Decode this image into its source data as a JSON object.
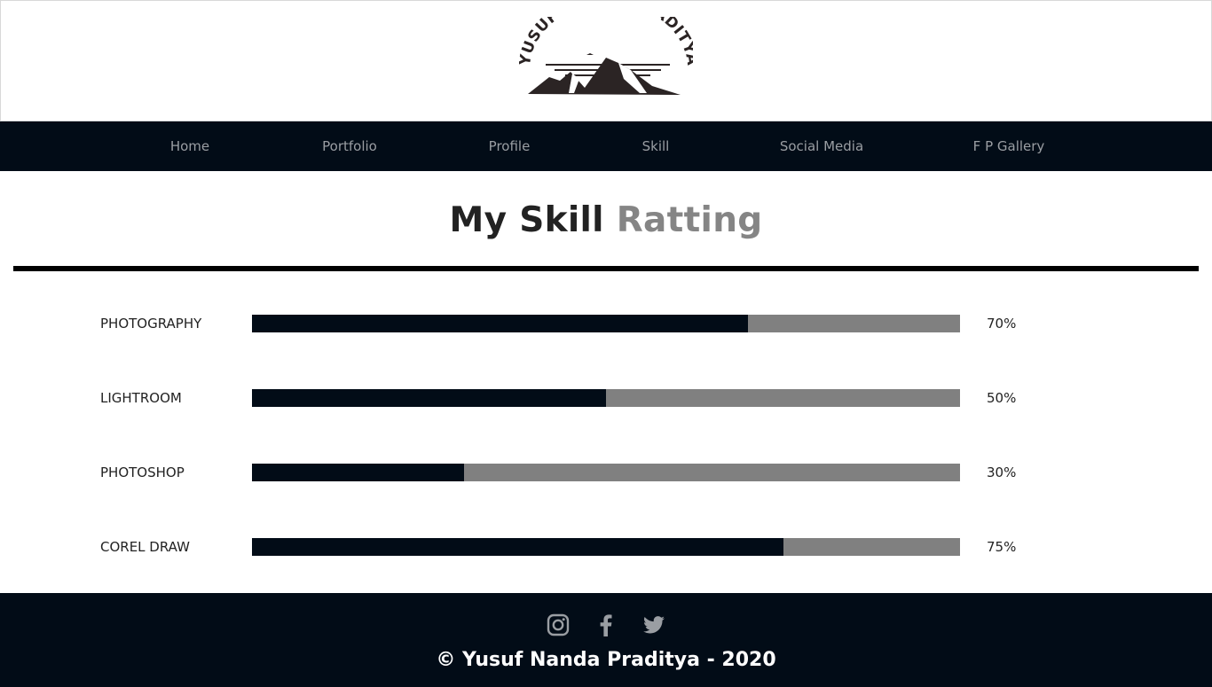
{
  "header": {
    "logo_text": "YUSUF NANDA PRADITYA"
  },
  "nav": {
    "items": [
      {
        "label": "Home"
      },
      {
        "label": "Portfolio"
      },
      {
        "label": "Profile"
      },
      {
        "label": "Skill"
      },
      {
        "label": "Social Media"
      },
      {
        "label": "F P Gallery"
      }
    ]
  },
  "main": {
    "title_main": "My Skill",
    "title_accent": "Ratting"
  },
  "skills": [
    {
      "name": "PHOTOGRAPHY",
      "percent": 70,
      "value_label": "70%"
    },
    {
      "name": "LIGHTROOM",
      "percent": 50,
      "value_label": "50%"
    },
    {
      "name": "PHOTOSHOP",
      "percent": 30,
      "value_label": "30%"
    },
    {
      "name": "COREL DRAW",
      "percent": 75,
      "value_label": "75%"
    }
  ],
  "footer": {
    "social_icons": [
      "instagram-icon",
      "facebook-icon",
      "twitter-icon"
    ],
    "copyright": "© Yusuf Nanda Praditya - 2020"
  },
  "colors": {
    "dark": "#020c17",
    "bar_track": "#808080",
    "accent_gray": "#858585",
    "nav_text": "#9a9ea3"
  }
}
